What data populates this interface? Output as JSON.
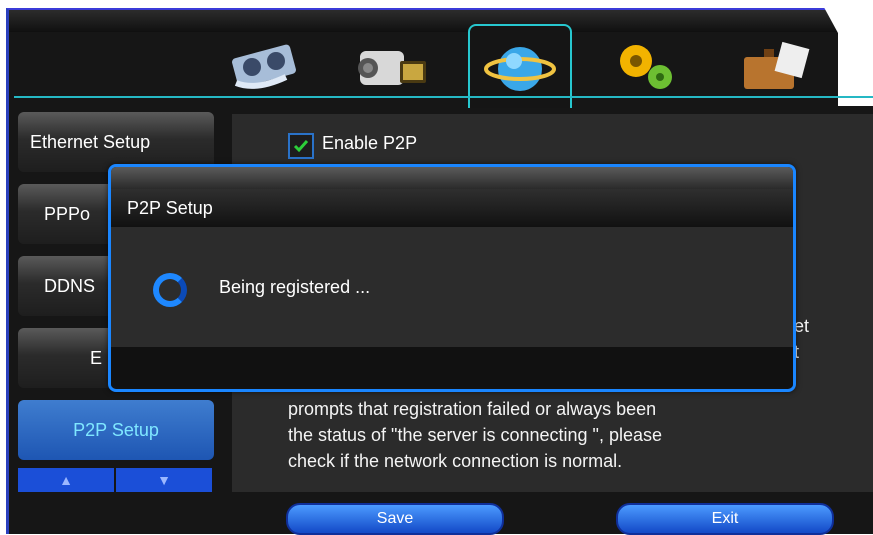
{
  "toolbar": {
    "tabs": [
      {
        "icon": "videotape-icon"
      },
      {
        "icon": "camera-icon"
      },
      {
        "icon": "network-globe-icon"
      },
      {
        "icon": "gears-icon"
      },
      {
        "icon": "toolbox-icon"
      }
    ]
  },
  "sidebar": {
    "items": [
      {
        "label": "Ethernet Setup"
      },
      {
        "label": "PPPo"
      },
      {
        "label": "DDNS"
      },
      {
        "label": "E"
      },
      {
        "label": "P2P Setup"
      }
    ],
    "up_label": "▲",
    "down_label": "▼"
  },
  "main": {
    "enable_p2p_label": "Enable P2P",
    "enable_p2p_checked": true,
    "partial_right_1": "get",
    "partial_right_2": "ut",
    "help_lines": [
      "prompts that registration failed or always been",
      "the status of \"the server is connecting \", please",
      "check if the network connection is normal."
    ]
  },
  "dialog": {
    "title": "P2P Setup",
    "message": "Being registered ..."
  },
  "buttons": {
    "save_label": "Save",
    "exit_label": "Exit"
  },
  "colors": {
    "accent_cyan": "#27c7cf",
    "dialog_border": "#1a86ff",
    "active_blue": "#1e56b3"
  }
}
